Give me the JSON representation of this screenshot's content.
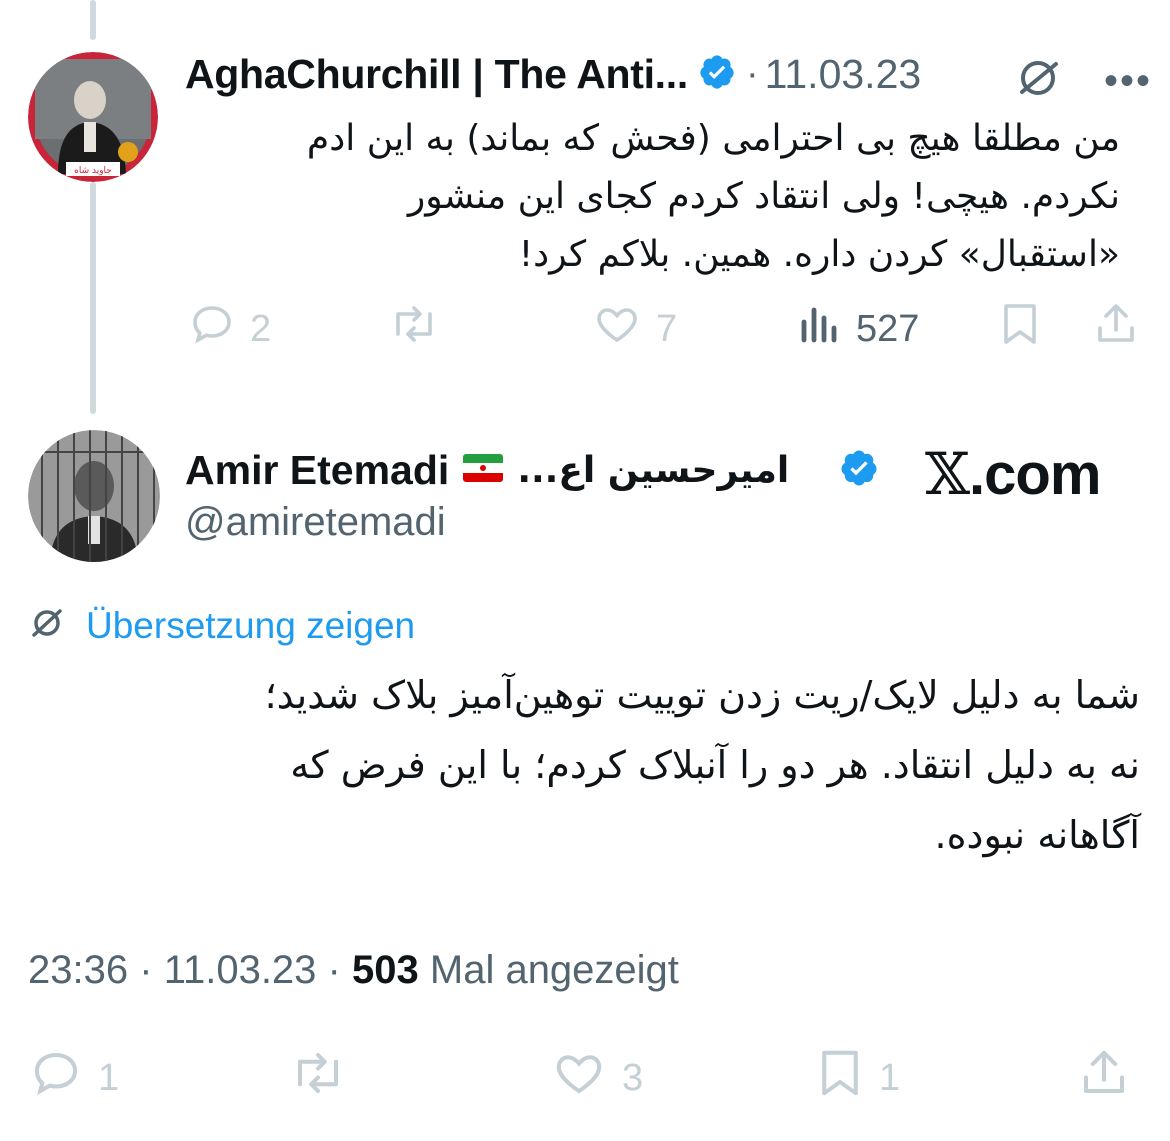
{
  "tweet1": {
    "display_name": "AghaChurchill | The Anti...",
    "date": "11.03.23",
    "avatar_caption": "جاوید شاه",
    "text_lines": [
      "من مطلقا هیچ بی احترامی (فحش که بماند) به این ادم",
      "نکردم. هیچی! ولی انتقاد کردم کجای این منشور",
      "«استقبال» کردن داره. همین. بلاکم کرد!"
    ],
    "stats": {
      "replies": "2",
      "likes": "7",
      "views": "527"
    }
  },
  "tweet2": {
    "display_name": "Amir Etemadi",
    "name_fa": "امیرحسین اع...",
    "handle": "@amiretemadi",
    "watermark": "X.com",
    "watermark_x": "𝕏",
    "watermark_rest": ".com",
    "translate_label": "Übersetzung zeigen",
    "text_lines": [
      "شما به دلیل لایک/ریت زدن توییت توهین‌آمیز بلاک شدید؛",
      "نه به دلیل انتقاد. هر دو را آنبلاک کردم؛ با این فرض که",
      "آگاهانه نبوده."
    ],
    "meta": {
      "time": "23:36",
      "sep": "·",
      "date": "11.03.23",
      "views": "503",
      "views_label": "Mal angezeigt"
    },
    "stats": {
      "replies": "1",
      "likes": "3",
      "bookmarks": "1"
    }
  },
  "colors": {
    "verified": "#1d9bf0",
    "link": "#1d9bf0",
    "muted": "#536471",
    "faint": "#c4cfd6"
  }
}
